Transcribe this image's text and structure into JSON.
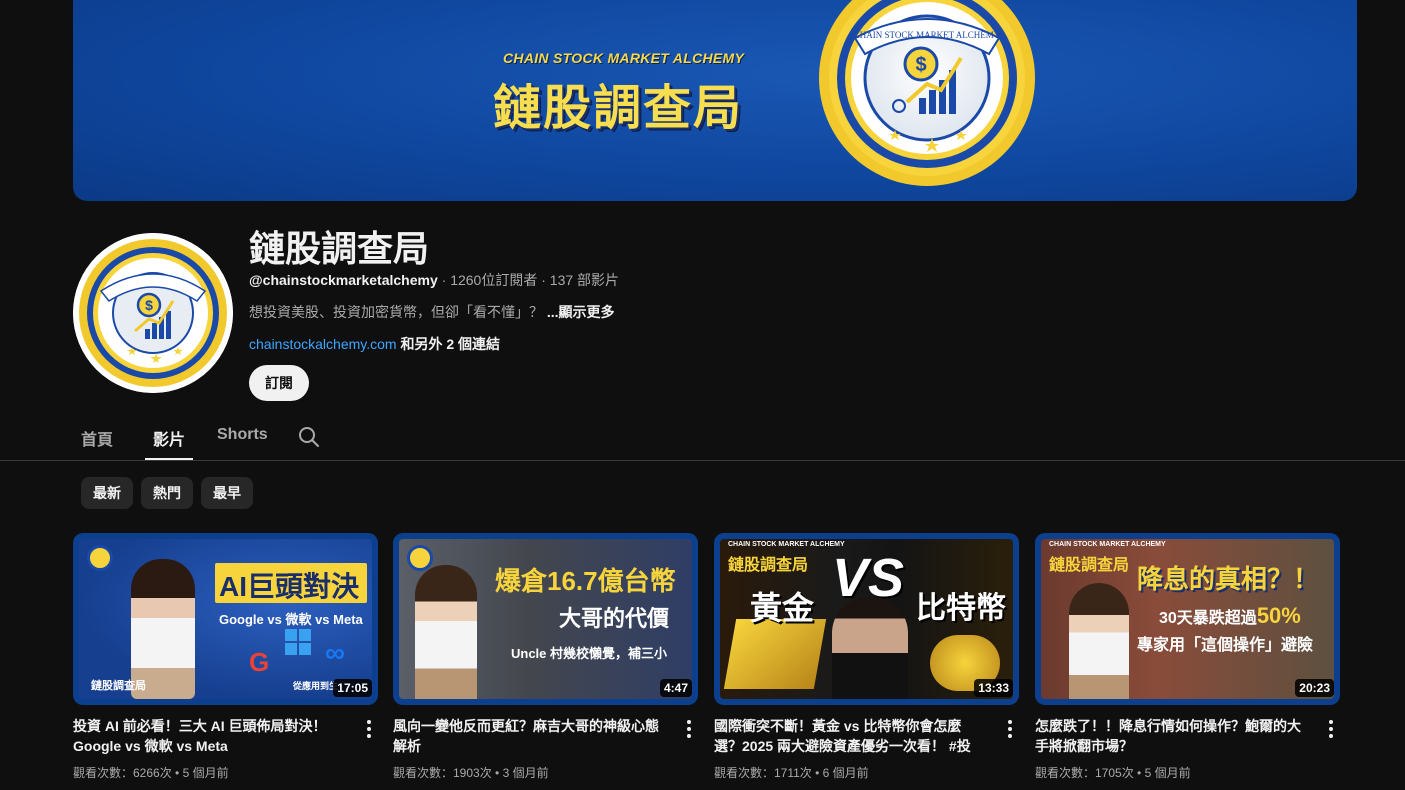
{
  "banner": {
    "subtitle": "CHAIN STOCK MARKET ALCHEMY",
    "title": "鏈股調查局",
    "badge_text": "CHAIN STOCK MARKET ALCHEMY",
    "colors": {
      "bg": "#0f479f",
      "gold": "#f7de4e"
    }
  },
  "channel": {
    "name": "鏈股調查局",
    "handle": "@chainstockmarketalchemy",
    "stats": " · 1260位訂閱者 · 137 部影片",
    "description": "想投資美股、投資加密貨幣，但卻「看不懂」？ ",
    "more_label": "...顯示更多",
    "link": "chainstockalchemy.com",
    "extra_links": " 和另外 2 個連結",
    "subscribe_label": "訂閱"
  },
  "tabs": [
    {
      "label": "首頁",
      "active": false
    },
    {
      "label": "影片",
      "active": true
    },
    {
      "label": "Shorts",
      "active": false
    }
  ],
  "chips": [
    {
      "label": "最新"
    },
    {
      "label": "熱門"
    },
    {
      "label": "最早"
    }
  ],
  "videos": [
    {
      "title": "投資 AI 前必看！三大 AI 巨頭佈局對決！Google vs 微軟 vs Meta",
      "meta": "觀看次數：6266次 • 5 個月前",
      "duration": "17:05",
      "thumb": {
        "line1": "AI巨頭對決",
        "line2": "Google vs 微軟 vs Meta",
        "brand": "鏈股調查局",
        "footer": "從應用到生"
      }
    },
    {
      "title": "風向一變他反而更紅？麻吉大哥的神級心態解析",
      "meta": "觀看次數：1903次 • 3 個月前",
      "duration": "4:47",
      "thumb": {
        "line1": "爆倉16.7億台幣",
        "line2": "大哥的代價",
        "line3": "Uncle 村幾校懶覺，補三小"
      }
    },
    {
      "title": "國際衝突不斷！黃金 vs 比特幣你會怎麼選？2025 兩大避險資產優劣一次看！ #投資 #黃...",
      "meta": "觀看次數：1711次 • 6 個月前",
      "duration": "13:33",
      "thumb": {
        "brand": "鏈股調查局",
        "left": "黃金",
        "vs": "VS",
        "right": "比特幣",
        "sub": "CHAIN STOCK MARKET ALCHEMY"
      }
    },
    {
      "title": "怎麼跌了！！降息行情如何操作？鮑爾的大手將掀翻市場？",
      "meta": "觀看次數：1705次 • 5 個月前",
      "duration": "20:23",
      "thumb": {
        "brand": "鏈股調查局",
        "line1": "降息的真相？！",
        "line2a": "30天暴跌超過",
        "line2b": "50%",
        "line3": "專家用「這個操作」避險",
        "sub": "CHAIN STOCK MARKET ALCHEMY"
      }
    }
  ]
}
